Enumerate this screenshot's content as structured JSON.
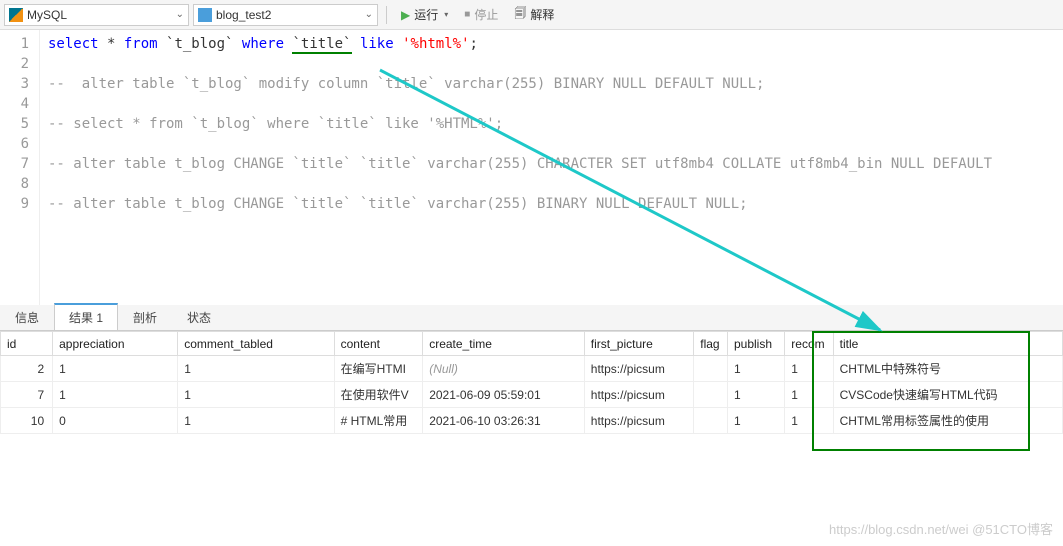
{
  "toolbar": {
    "connection": "MySQL",
    "database": "blog_test2",
    "run": "运行",
    "stop": "停止",
    "explain": "解释"
  },
  "editor": {
    "lines": [
      {
        "n": 1,
        "seg": [
          {
            "t": "select",
            "c": "kw"
          },
          {
            "t": " * ",
            "c": ""
          },
          {
            "t": "from",
            "c": "kw"
          },
          {
            "t": " `t_blog` ",
            "c": ""
          },
          {
            "t": "where",
            "c": "kw"
          },
          {
            "t": " ",
            "c": ""
          },
          {
            "t": "`title`",
            "c": "underline-green"
          },
          {
            "t": " ",
            "c": ""
          },
          {
            "t": "like",
            "c": "kw"
          },
          {
            "t": " ",
            "c": ""
          },
          {
            "t": "'%html%'",
            "c": "str"
          },
          {
            "t": ";",
            "c": ""
          }
        ]
      },
      {
        "n": 2,
        "seg": []
      },
      {
        "n": 3,
        "seg": [
          {
            "t": "--  alter table `t_blog` modify column `title` varchar(255) BINARY NULL DEFAULT NULL;",
            "c": "comment"
          }
        ]
      },
      {
        "n": 4,
        "seg": []
      },
      {
        "n": 5,
        "seg": [
          {
            "t": "-- select * from `t_blog` where `title` like '%HTML%';",
            "c": "comment"
          }
        ]
      },
      {
        "n": 6,
        "seg": []
      },
      {
        "n": 7,
        "seg": [
          {
            "t": "-- alter table t_blog CHANGE `title` `title` varchar(255) CHARACTER SET utf8mb4 COLLATE utf8mb4_bin NULL DEFAULT",
            "c": "comment"
          }
        ]
      },
      {
        "n": 8,
        "seg": []
      },
      {
        "n": 9,
        "seg": [
          {
            "t": "-- alter table t_blog CHANGE `title` `title` varchar(255) BINARY NULL DEFAULT NULL;",
            "c": "comment"
          }
        ]
      }
    ]
  },
  "tabs": {
    "info": "信息",
    "result": "结果 1",
    "profile": "剖析",
    "status": "状态"
  },
  "results": {
    "headers": [
      "id",
      "appreciation",
      "comment_tabled",
      "content",
      "create_time",
      "first_picture",
      "flag",
      "publish",
      "recom",
      "title"
    ],
    "rows": [
      {
        "id": "2",
        "appreciation": "1",
        "comment_tabled": "1",
        "content": "在编写HTMI",
        "create_time": "(Null)",
        "first_picture": "https://picsum",
        "flag": "",
        "publish": "1",
        "recom": "1",
        "extra": "C",
        "title": "HTML中特殊符号"
      },
      {
        "id": "7",
        "appreciation": "1",
        "comment_tabled": "1",
        "content": "在使用软件V",
        "create_time": "2021-06-09 05:59:01",
        "first_picture": "https://picsum",
        "flag": "",
        "publish": "1",
        "recom": "1",
        "extra": "C",
        "title": "VSCode快速编写HTML代码"
      },
      {
        "id": "10",
        "appreciation": "0",
        "comment_tabled": "1",
        "content": "# HTML常用",
        "create_time": "2021-06-10 03:26:31",
        "first_picture": "https://picsum",
        "flag": "",
        "publish": "1",
        "recom": "1",
        "extra": "C",
        "title": "HTML常用标签属性的使用"
      }
    ]
  },
  "watermark": "https://blog.csdn.net/wei  @51CTO博客"
}
